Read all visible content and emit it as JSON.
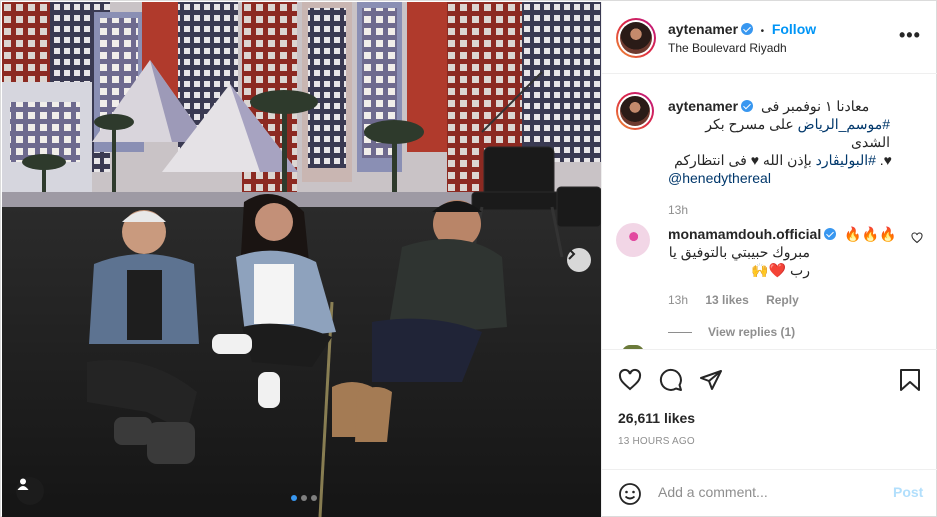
{
  "post_header": {
    "username": "aytenamer",
    "follow_label": "Follow",
    "separator": "•",
    "location": "The Boulevard Riyadh",
    "more_label": "•••"
  },
  "caption": {
    "username": "aytenamer",
    "line1": "معادنا ١ نوفمبر فى",
    "line2_hashtag": "#موسم_الرياض",
    "line2_rest": " على مسرح بكر الشدى",
    "line3_hashtag": "#البوليڤارد",
    "line3_rest": " بإذن الله ♥ فى انتظاركم",
    "line3_prefix": "♥.",
    "mention": "@henedythereal",
    "time": "13h"
  },
  "comment": {
    "username": "monamamdouh.official",
    "emoji": "🔥🔥🔥",
    "text": "مبروك حبيبتي بالتوفيق يا رب ❤️🙌",
    "time": "13h",
    "likes": "13 likes",
    "reply_label": "Reply",
    "view_replies": "View replies (1)"
  },
  "engagement": {
    "likes": "26,611 likes",
    "time_ago": "13 HOURS AGO"
  },
  "add_comment": {
    "placeholder": "Add a comment...",
    "post_label": "Post"
  },
  "carousel": {
    "slides": 3,
    "active_index": 0
  },
  "colors": {
    "link_blue": "#0095f6",
    "verified_blue": "#3897f0",
    "hashtag": "#00376b",
    "muted": "#8e8e8e"
  },
  "icons": [
    "next-arrow-icon",
    "user-tag-icon",
    "verified-icon",
    "more-icon",
    "heart-icon",
    "comment-icon",
    "share-icon",
    "save-icon",
    "emoji-icon"
  ]
}
